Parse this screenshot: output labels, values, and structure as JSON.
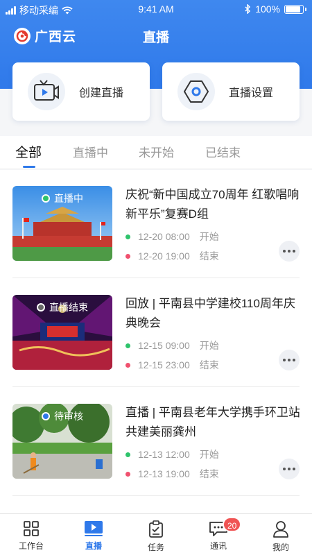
{
  "status_bar": {
    "carrier": "移动采编",
    "time": "9:41 AM",
    "battery": "100%"
  },
  "header": {
    "logo_text": "广西云",
    "title": "直播"
  },
  "actions": {
    "create_label": "创建直播",
    "settings_label": "直播设置"
  },
  "tabs": [
    {
      "label": "全部"
    },
    {
      "label": "直播中"
    },
    {
      "label": "未开始"
    },
    {
      "label": "已结束"
    }
  ],
  "items": [
    {
      "badge": "直播中",
      "title": "庆祝“新中国成立70周年 红歌唱响新平乐”复赛D组",
      "start_time": "12-20 08:00",
      "start_label": "开始",
      "end_time": "12-20 19:00",
      "end_label": "结束"
    },
    {
      "badge": "直播结束",
      "title": "回放 | 平南县中学建校110周年庆典晚会",
      "start_time": "12-15 09:00",
      "start_label": "开始",
      "end_time": "12-15 23:00",
      "end_label": "结束"
    },
    {
      "badge": "待审核",
      "title": "直播 | 平南县老年大学携手环卫站共建美丽龚州",
      "start_time": "12-13 12:00",
      "start_label": "开始",
      "end_time": "12-13 19:00",
      "end_label": "结束"
    }
  ],
  "tabbar": [
    {
      "label": "工作台",
      "icon": "grid-icon"
    },
    {
      "label": "直播",
      "icon": "video-play-icon"
    },
    {
      "label": "任务",
      "icon": "clipboard-icon"
    },
    {
      "label": "通讯",
      "icon": "chat-icon",
      "badge": "20"
    },
    {
      "label": "我的",
      "icon": "user-icon"
    }
  ],
  "colors": {
    "primary": "#2f79ea",
    "live_start_dot": "#2ec36b",
    "live_end_dot": "#f0506e",
    "badge_red": "#f05454"
  }
}
